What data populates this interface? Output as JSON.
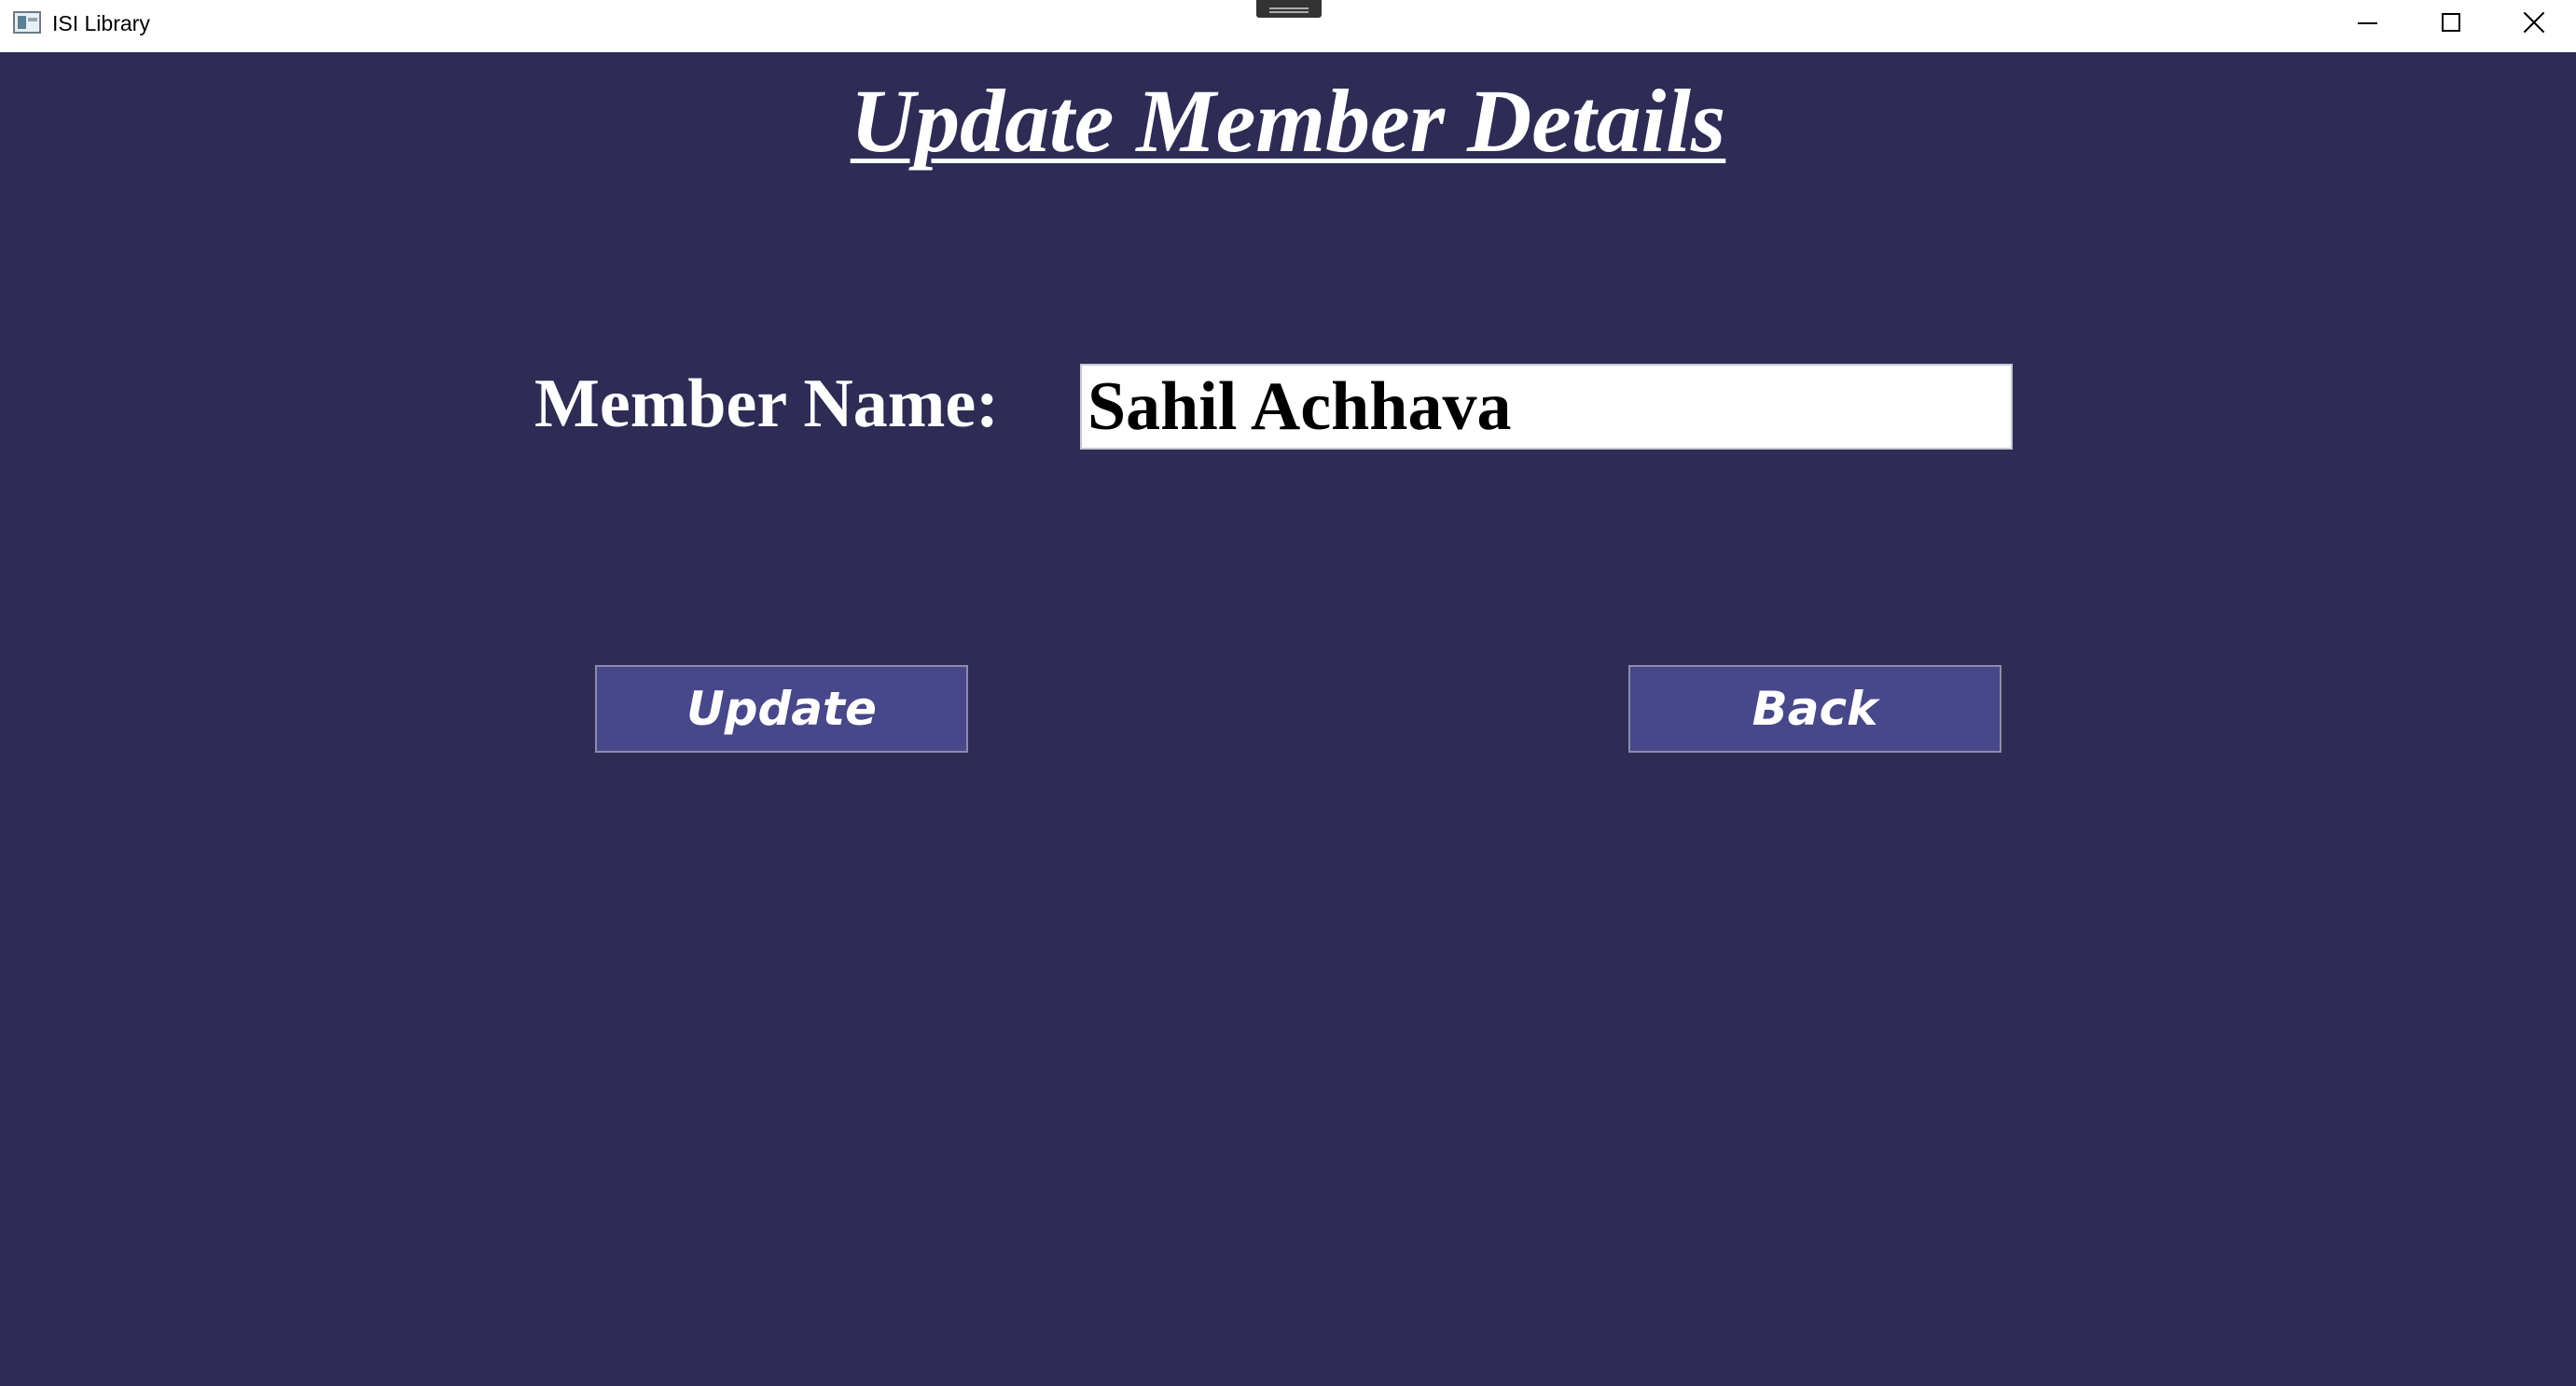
{
  "window": {
    "title": "ISI Library",
    "icons": {
      "app": "app-window-icon",
      "minimize": "minimize-icon",
      "maximize": "maximize-icon",
      "close": "close-icon"
    }
  },
  "page": {
    "title": "Update Member Details",
    "member_name_label": "Member Name:",
    "member_name_value": "Sahil Achhava",
    "buttons": {
      "update": "Update",
      "back": "Back"
    },
    "colors": {
      "background": "#2e2c55",
      "button_fill": "#47478a",
      "input_background": "#ffffff",
      "text": "#ffffff"
    }
  }
}
